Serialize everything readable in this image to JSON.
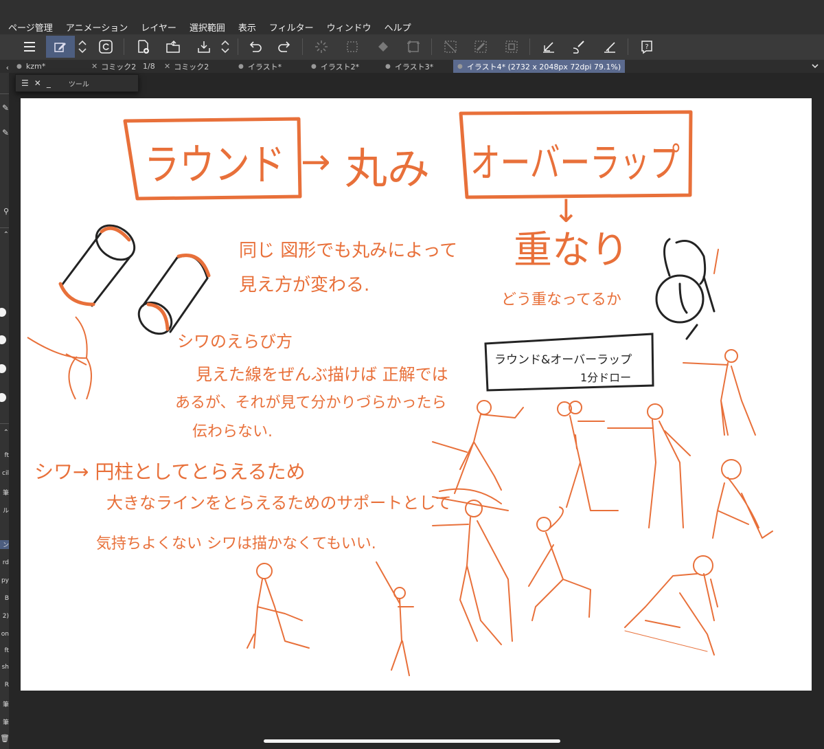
{
  "menu": {
    "items": [
      "ページ管理",
      "アニメーション",
      "レイヤー",
      "選択範囲",
      "表示",
      "フィルター",
      "ウィンドウ",
      "ヘルプ"
    ]
  },
  "toolbar": {
    "icons": [
      "menu-icon",
      "pen-edit-icon",
      "up-down-arrows-icon",
      "clip-studio-logo-icon",
      "new-document-icon",
      "open-folder-icon",
      "save-icon",
      "up-down-arrows-icon",
      "undo-icon",
      "redo-icon",
      "loading-icon",
      "transform-icon",
      "fill-icon",
      "select-all-icon",
      "deselect-icon",
      "invert-selection-icon",
      "crop-icon",
      "pen-line-icon",
      "brush-icon",
      "ruler-pen-icon",
      "help-icon"
    ]
  },
  "tabs": [
    {
      "label": "kzm*",
      "kind": "dot"
    },
    {
      "label": "コミック2",
      "kind": "x"
    },
    {
      "label": "1/8",
      "kind": "plain"
    },
    {
      "label": "コミック2",
      "kind": "x"
    },
    {
      "label": "イラスト*",
      "kind": "dot"
    },
    {
      "label": "イラスト2*",
      "kind": "dot"
    },
    {
      "label": "イラスト3*",
      "kind": "dot"
    },
    {
      "label": "イラスト4* (2732 x 2048px 72dpi 79.1%)",
      "kind": "active"
    }
  ],
  "tool_panel": {
    "menu_glyph": "☰",
    "close_glyph": "✕",
    "minimize_glyph": "_",
    "title": "ツール"
  },
  "left_palette": {
    "tags": [
      "ft",
      "cil",
      "筆",
      "ル",
      "ン",
      "rd",
      "py",
      "B",
      "2)",
      "on",
      "ft",
      "sh",
      "R",
      "筆",
      "筆"
    ]
  },
  "canvas": {
    "title_left": "ラウンド",
    "arrow1": "→",
    "title_mid": "丸み",
    "title_right": "オーバーラップ",
    "arrow_down": "↓",
    "overlap_heading": "重なり",
    "overlap_sub": "どう重なってるか",
    "round_note_1": "同じ 図形でも丸みによって",
    "round_note_2": "見え方が変わる.",
    "wrinkle_heading": "シワのえらび方",
    "wrinkle_1": "見えた線をぜんぶ描けば 正解では",
    "wrinkle_2": "あるが、それが見て分かりづらかったら",
    "wrinkle_3": "伝わらない.",
    "wrinkle2_heading": "シワ→ 円柱としてとらえるため",
    "wrinkle2_line": "大きなラインをとらえるためのサポートとして",
    "wrinkle2_note": "気持ちよくない シワは描かなくてもいい.",
    "box_1": "ラウンド&オーバーラップ",
    "box_2": "1分ドロー"
  },
  "colors": {
    "sketch_orange": "#e8703a",
    "sketch_dark": "#232323",
    "active_tab": "#5b6a8e"
  }
}
